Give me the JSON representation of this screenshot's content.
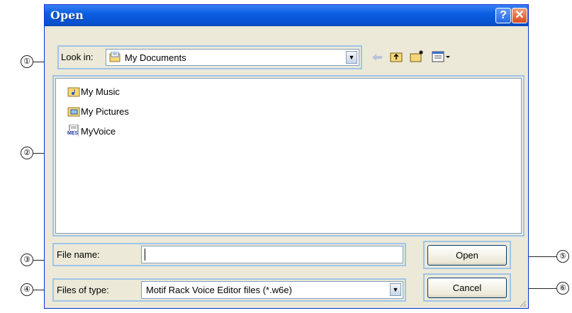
{
  "dialog": {
    "title": "Open",
    "help_glyph": "?",
    "close_glyph": "✕"
  },
  "toolbar": {
    "look_in_label": "Look in:",
    "look_in_value": "My Documents",
    "icons": [
      "back-icon",
      "up-folder-icon",
      "new-folder-icon",
      "views-menu-icon"
    ]
  },
  "files": [
    {
      "name": "My Music",
      "icon": "music-folder-icon"
    },
    {
      "name": "My Pictures",
      "icon": "pictures-folder-icon"
    },
    {
      "name": "MyVoice",
      "icon": "mes-file-icon",
      "badge": "MES"
    }
  ],
  "filename": {
    "label": "File name:",
    "value": ""
  },
  "filetype": {
    "label": "Files of type:",
    "value": "Motif Rack Voice Editor files (*.w6e)"
  },
  "buttons": {
    "open": "Open",
    "cancel": "Cancel"
  },
  "callouts": [
    "①",
    "②",
    "③",
    "④",
    "⑤",
    "⑥"
  ],
  "colors": {
    "title_bar": "#0a5fe4",
    "dialog_bg": "#ece9d8",
    "callout_frame": "#9ec4ea",
    "close": "#d64d1e"
  }
}
